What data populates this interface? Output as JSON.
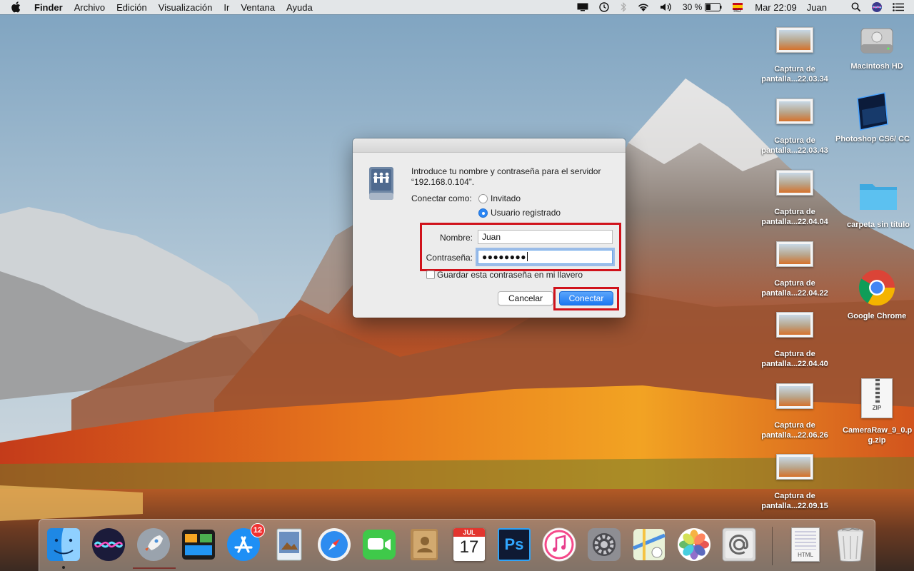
{
  "menubar": {
    "app_name": "Finder",
    "menus": [
      "Archivo",
      "Edición",
      "Visualización",
      "Ir",
      "Ventana",
      "Ayuda"
    ],
    "battery_percent": "30 %",
    "clock": "Mar 22:09",
    "user": "Juan",
    "input_flag_label": "ISO",
    "icons": [
      "apple-icon",
      "display-icon",
      "time-machine-icon",
      "bluetooth-icon",
      "wifi-icon",
      "volume-icon",
      "battery-icon",
      "flag-icon",
      "search-icon",
      "siri-icon",
      "list-icon"
    ]
  },
  "desktop": {
    "screenshots": [
      {
        "line1": "Captura de",
        "line2": "pantalla...22.03.34"
      },
      {
        "line1": "Captura de",
        "line2": "pantalla...22.03.43"
      },
      {
        "line1": "Captura de",
        "line2": "pantalla...22.04.04"
      },
      {
        "line1": "Captura de",
        "line2": "pantalla...22.04.22"
      },
      {
        "line1": "Captura de",
        "line2": "pantalla...22.04.40"
      },
      {
        "line1": "Captura de",
        "line2": "pantalla...22.06.26"
      },
      {
        "line1": "Captura de",
        "line2": "pantalla...22.09.15"
      }
    ],
    "items": {
      "macintosh_hd": "Macintosh HD",
      "photoshop": "Photoshop CS6/ CC",
      "folder": "carpeta sin título",
      "chrome": "Google Chrome",
      "zip": "CameraRaw_9_0.p g.zip",
      "zip_badge": "ZIP"
    }
  },
  "dialog": {
    "prompt_line1": "Introduce tu nombre y contraseña para el servidor",
    "prompt_line2": "“192.168.0.104”.",
    "connect_as_label": "Conectar como:",
    "radio_guest": "Invitado",
    "radio_registered": "Usuario registrado",
    "radio_selected": "Usuario registrado",
    "name_label": "Nombre:",
    "name_value": "Juan",
    "password_label": "Contraseña:",
    "password_value": "●●●●●●●●",
    "keychain_label": "Guardar esta contraseña en mi llavero",
    "keychain_checked": false,
    "cancel_label": "Cancelar",
    "connect_label": "Conectar",
    "highlight_color": "#d0121b",
    "accent_color": "#1c78f2"
  },
  "dock": {
    "app_store_badge": "12",
    "calendar_month": "JUL",
    "calendar_day": "17",
    "photoshop_label": "Ps",
    "html_label": "HTML",
    "apps": [
      "Finder",
      "Siri",
      "Launchpad",
      "Mission Control",
      "App Store",
      "Preview",
      "Safari",
      "FaceTime",
      "Contactos",
      "Calendario",
      "Photoshop",
      "iTunes",
      "Preferencias del Sistema",
      "Mapas",
      "Fotos",
      "Mail",
      "Documento HTML",
      "Papelera"
    ]
  }
}
